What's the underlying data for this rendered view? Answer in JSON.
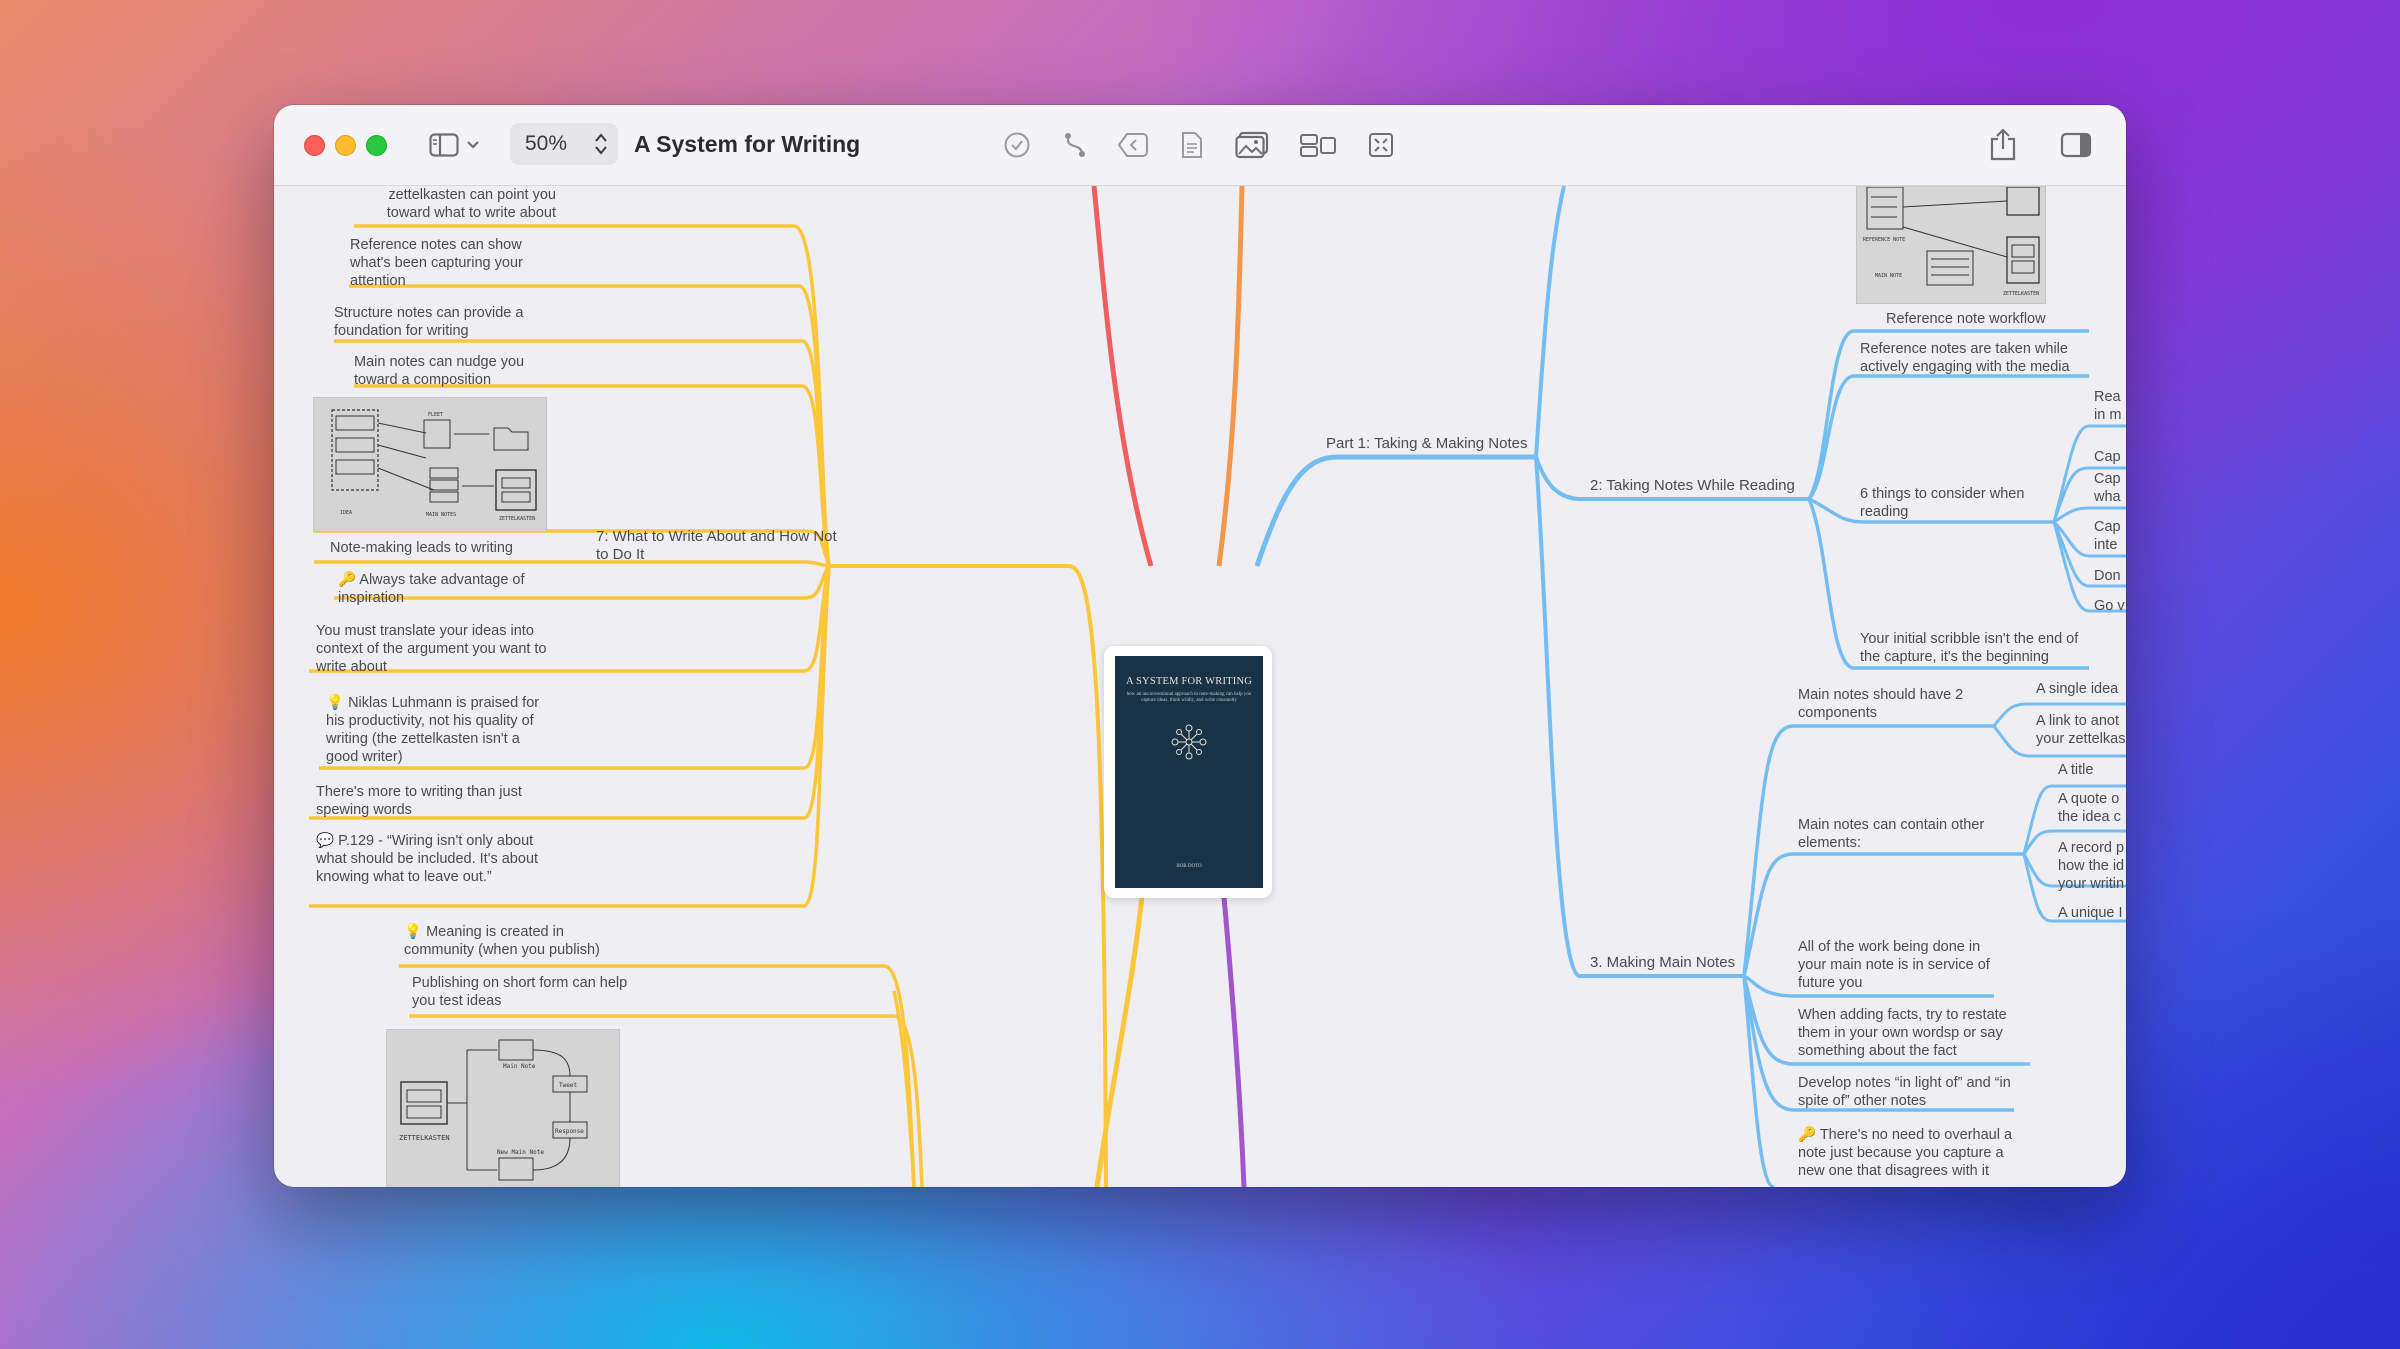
{
  "window": {
    "title": "A System for Writing",
    "zoom": "50%"
  },
  "toolbar": {
    "icons": [
      "sidebar-icon",
      "chevron-down-icon",
      "zoom-stepper-icon",
      "checkmark-circle-icon",
      "connection-icon",
      "collapse-arrow-icon",
      "note-icon",
      "image-icon",
      "layout-icon",
      "focus-icon",
      "share-icon",
      "inspector-icon"
    ]
  },
  "colors": {
    "yellow": "#fcc63a",
    "blue": "#74bdf2",
    "red": "#ef5f5f",
    "orange": "#f3984a",
    "purple": "#a155cc",
    "book_cover": "#183247"
  },
  "book": {
    "title": "A SYSTEM FOR WRITING",
    "subtitle": "how an unconventional approach to note-making can help you capture ideas, think wildly, and write constantly",
    "author": "BOB DOTO"
  },
  "left": {
    "branch": "7: What to Write About and How Not to Do It",
    "nodes": [
      "zettelkasten can point you toward what to write about",
      "Reference notes can show what's been capturing your attention",
      "Structure notes can provide a foundation for writing",
      "Main notes can nudge you toward a composition",
      "Note-making leads to writing",
      "🔑 Always take advantage of inspiration",
      "You must translate your ideas into context of the argument you want to write about",
      "💡 Niklas Luhmann is praised for his productivity, not his quality of writing (the zettelkasten isn't a good writer)",
      "There's more to writing than just spewing words",
      "💬 P.129 - “Wiring isn't only about what should be included. It's about knowing what to leave out.”"
    ],
    "lower_nodes": [
      "💡 Meaning is created in community (when you publish)",
      "Publishing on short form can help you test ideas"
    ]
  },
  "right": {
    "part": "Part 1: Taking & Making Notes",
    "reading": {
      "label": "2: Taking Notes While Reading",
      "nodes": [
        "Reference note workflow",
        "Reference notes are taken while actively engaging with the media",
        "6 things to consider when reading",
        "Your initial scribble isn't the end of the capture, it's the beginning"
      ],
      "considerations": [
        "Rea in m",
        "Cap",
        "Cap wha",
        "Cap inte",
        "Don",
        "Go v"
      ]
    },
    "main_notes": {
      "label": "3. Making Main Notes",
      "nodes": [
        "Main notes should have 2 components",
        "Main notes can contain other elements:",
        "All of the work being done in your main note is in service of future you",
        "When adding facts, try to restate them in your own wordsp or say something about the fact",
        "Develop notes “in light of” and “in spite of” other notes",
        "🔑 There's no need to overhaul a note just because you capture a new one that disagrees with it"
      ],
      "components": [
        "A single idea",
        "A link to anot your zettelkas"
      ],
      "elements": [
        "A title",
        "A quote o the idea c",
        "A record p how the id your writin",
        "A unique I"
      ]
    }
  },
  "diagram_labels": {
    "first": [
      "IDEA",
      "FLEET",
      "MAIN NOTES",
      "ZETTELKASTEN",
      "INBOX",
      "REFERENCES"
    ],
    "second": [
      "Main Note",
      "Tweet",
      "Response",
      "New Main Note",
      "ZETTELKASTEN"
    ],
    "third": [
      "ZETTELKASTEN",
      "REFERENCE NOTE",
      "MAIN NOTE"
    ]
  }
}
